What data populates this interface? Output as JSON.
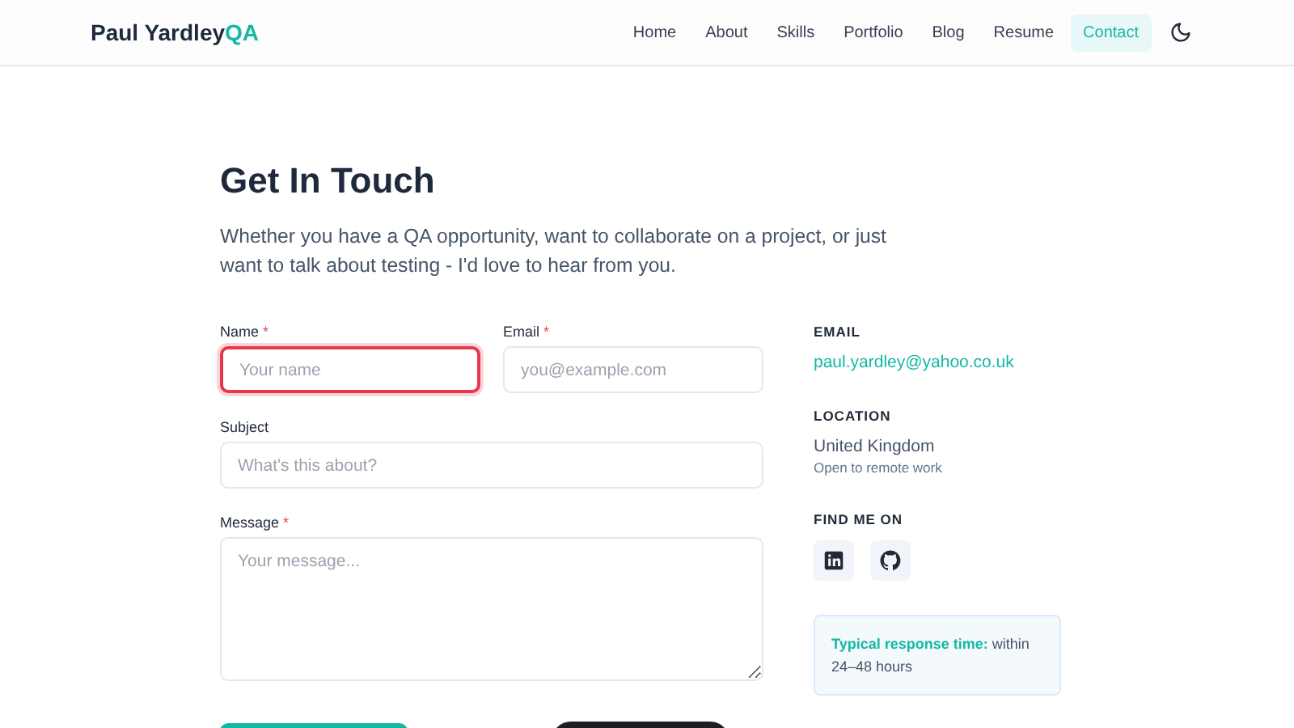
{
  "header": {
    "logo": "Paul Yardley",
    "logo_accent": "QA",
    "nav": [
      {
        "label": "Home",
        "selected": false
      },
      {
        "label": "About",
        "selected": false
      },
      {
        "label": "Skills",
        "selected": false
      },
      {
        "label": "Portfolio",
        "selected": false
      },
      {
        "label": "Blog",
        "selected": false
      },
      {
        "label": "Resume",
        "selected": false
      },
      {
        "label": "Contact",
        "selected": true
      }
    ]
  },
  "title": "Get In Touch",
  "intro": "Whether you have a QA opportunity, want to collaborate on a project, or just want to talk about testing - I'd love to hear from you.",
  "form": {
    "fields": [
      {
        "label": "Name",
        "required_mark": "*",
        "placeholder": "Your name",
        "error": true,
        "kind": "input"
      },
      {
        "label": "Email",
        "required_mark": "*",
        "placeholder": "you@example.com",
        "error": false,
        "kind": "input"
      },
      {
        "label": "Subject",
        "placeholder": "What's this about?",
        "error": false,
        "kind": "input"
      },
      {
        "label": "Message",
        "required_mark": "*",
        "placeholder": "Your message...",
        "error": false,
        "kind": "textarea"
      }
    ]
  },
  "contact": {
    "email_heading": "EMAIL",
    "email": "paul.yardley@yahoo.co.uk",
    "location_heading": "LOCATION",
    "location": "United Kingdom",
    "location_note": "Open to remote work",
    "social_heading": "FIND ME ON",
    "social": [
      {
        "kind": "linkedin"
      },
      {
        "kind": "github"
      }
    ],
    "note_lead": "Typical response time:",
    "note_text": "within 24–48 hours"
  }
}
